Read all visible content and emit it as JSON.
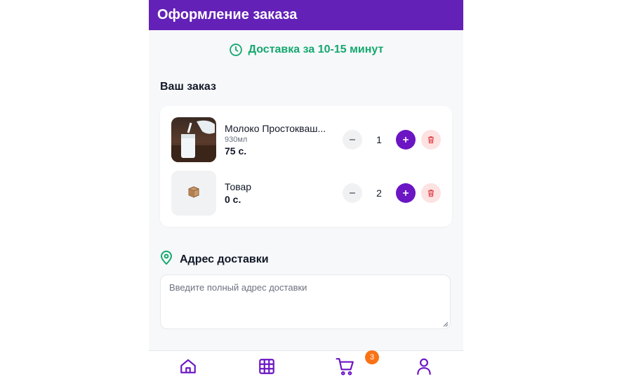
{
  "header": {
    "title": "Оформление заказа"
  },
  "delivery": {
    "text": "Доставка за 10-15 минут",
    "icon": "clock-icon",
    "color": "#14a86e"
  },
  "order": {
    "title": "Ваш заказ",
    "items": [
      {
        "name": "Молоко Простокваш...",
        "volume": "930мл",
        "price": "75 с.",
        "quantity": "1",
        "image": "milk-photo"
      },
      {
        "name": "Товар",
        "volume": "",
        "price": "0 с.",
        "quantity": "2",
        "image": "box-icon"
      }
    ]
  },
  "address": {
    "title": "Адрес доставки",
    "placeholder": "Введите полный адрес доставки",
    "icon": "location-pin-icon"
  },
  "nav": {
    "items": [
      {
        "name": "home",
        "icon": "home-icon"
      },
      {
        "name": "catalog",
        "icon": "grid-icon"
      },
      {
        "name": "cart",
        "icon": "cart-icon",
        "badge": "3"
      },
      {
        "name": "profile",
        "icon": "user-icon"
      }
    ]
  },
  "colors": {
    "primary": "#6321b8",
    "accent": "#6b15c4",
    "success": "#14a86e",
    "danger": "#e0454b",
    "badge": "#f97316"
  }
}
